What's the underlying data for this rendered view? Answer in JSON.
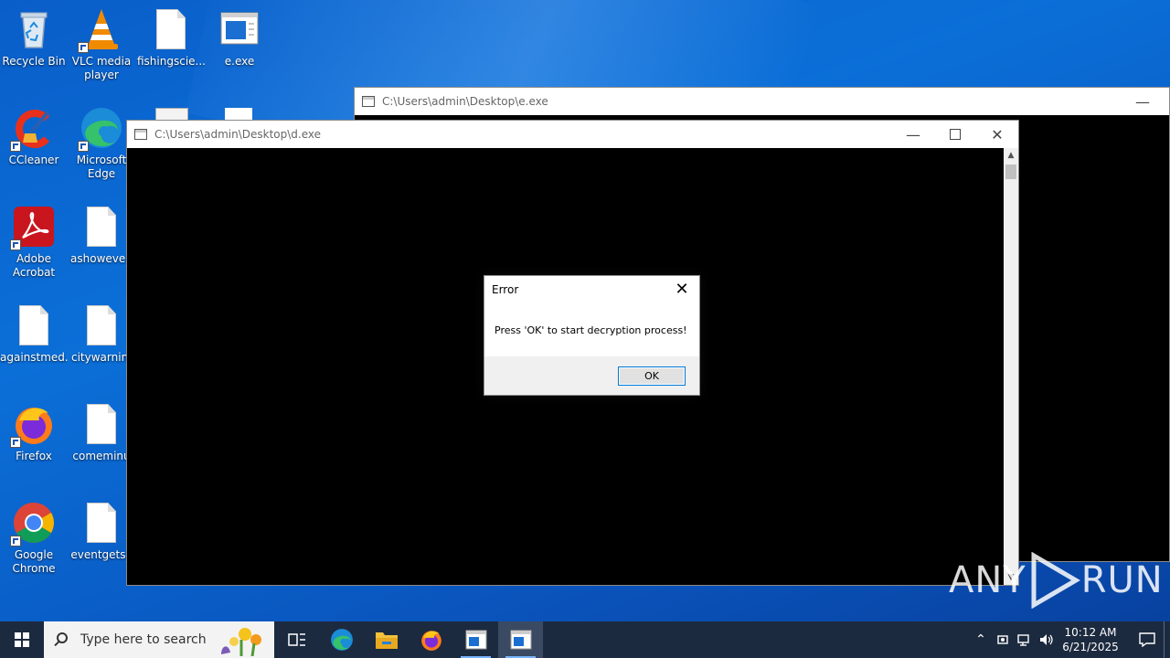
{
  "desktop": {
    "icons": [
      {
        "label": "Recycle Bin"
      },
      {
        "label": "VLC media player"
      },
      {
        "label": "fishingscie..."
      },
      {
        "label": "e.exe"
      },
      {
        "label": "CCleaner"
      },
      {
        "label": "Microsoft Edge"
      },
      {
        "label": "Adobe Acrobat"
      },
      {
        "label": "ashowever."
      },
      {
        "label": "againstmed..."
      },
      {
        "label": "citywarnin."
      },
      {
        "label": "Firefox"
      },
      {
        "label": "comeminu"
      },
      {
        "label": "Google Chrome"
      },
      {
        "label": "eventgets.j"
      }
    ]
  },
  "windows": {
    "back": {
      "title": "C:\\Users\\admin\\Desktop\\e.exe"
    },
    "front": {
      "title": "C:\\Users\\admin\\Desktop\\d.exe"
    }
  },
  "dialog": {
    "title": "Error",
    "message": "Press 'OK' to start decryption process!",
    "ok_label": "OK"
  },
  "taskbar": {
    "search_placeholder": "Type here to search",
    "time": "10:12 AM",
    "date": "6/21/2025"
  },
  "watermark": {
    "left": "ANY",
    "right": "RUN"
  },
  "colors": {
    "desktop_blue": "#0b6fd8",
    "taskbar": "#1c2a3f",
    "accent": "#0078d7"
  }
}
